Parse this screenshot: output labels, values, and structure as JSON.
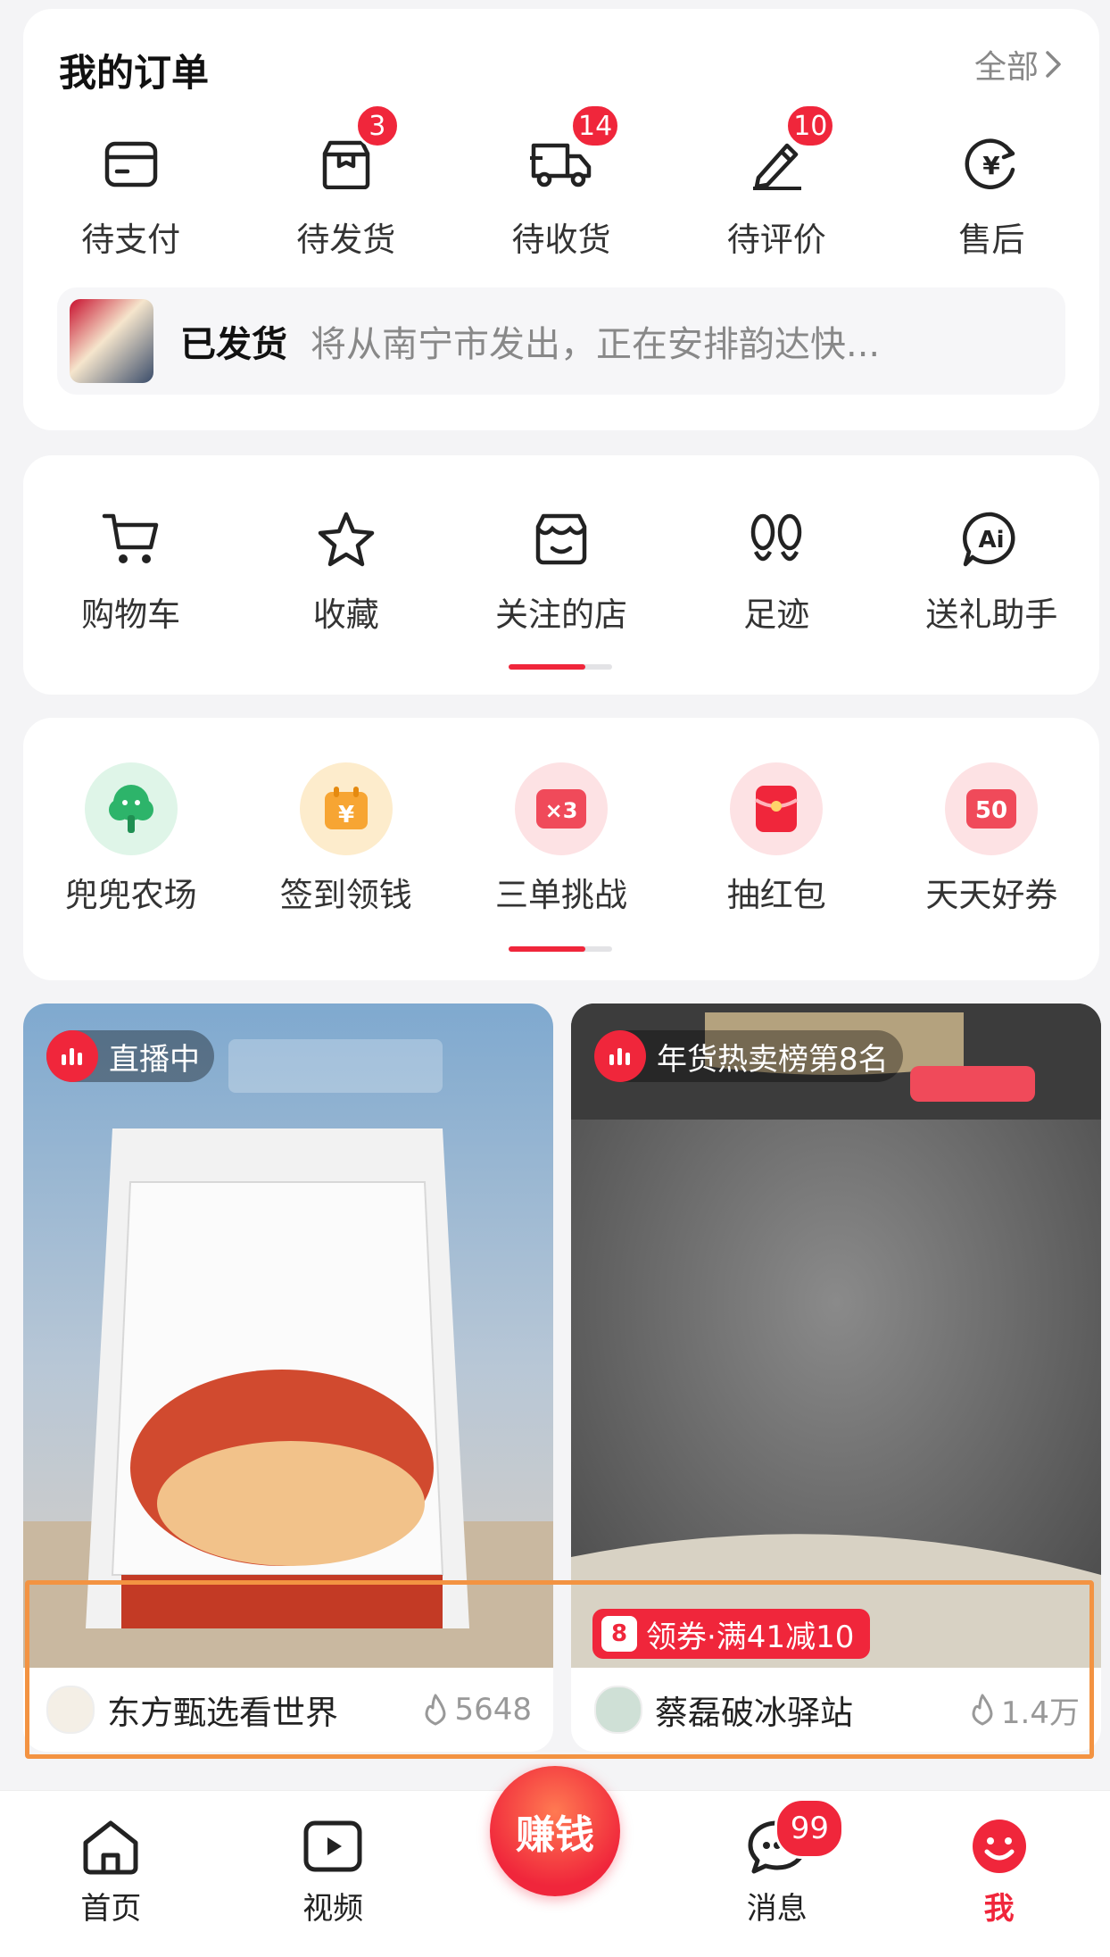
{
  "orders": {
    "title": "我的订单",
    "more": "全部",
    "items": [
      {
        "label": "待支付",
        "icon": "wallet-icon",
        "badge": ""
      },
      {
        "label": "待发货",
        "icon": "package-icon",
        "badge": "3"
      },
      {
        "label": "待收货",
        "icon": "truck-icon",
        "badge": "14"
      },
      {
        "label": "待评价",
        "icon": "pen-icon",
        "badge": "10"
      },
      {
        "label": "售后",
        "icon": "refund-icon",
        "badge": ""
      }
    ],
    "shipping": {
      "status": "已发货",
      "text": "将从南宁市发出，正在安排韵达快..."
    }
  },
  "tools": {
    "items": [
      {
        "label": "购物车",
        "icon": "cart-icon"
      },
      {
        "label": "收藏",
        "icon": "star-icon"
      },
      {
        "label": "关注的店",
        "icon": "store-icon"
      },
      {
        "label": "足迹",
        "icon": "footprint-icon"
      },
      {
        "label": "送礼助手",
        "icon": "ai-icon"
      }
    ]
  },
  "activities": {
    "items": [
      {
        "label": "兜兜农场",
        "icon": "tree-icon",
        "color": "#2db46a"
      },
      {
        "label": "签到领钱",
        "icon": "calendar-yen-icon",
        "color": "#f7a533"
      },
      {
        "label": "三单挑战",
        "icon": "ticket-x3-icon",
        "color": "#f04a5a",
        "glyph": "×3"
      },
      {
        "label": "抽红包",
        "icon": "red-envelope-icon",
        "color": "#f0263b"
      },
      {
        "label": "天天好券",
        "icon": "coupon-50-icon",
        "color": "#f04a5a",
        "glyph": "50"
      }
    ]
  },
  "feed": [
    {
      "tag": "直播中",
      "name": "东方甄选看世界",
      "heat": "5648",
      "coupon": ""
    },
    {
      "tag": "年货热卖榜第8名",
      "name": "蔡磊破冰驿站",
      "heat": "1.4万",
      "coupon": "领券·满41减10"
    }
  ],
  "nav": {
    "items": [
      {
        "label": "首页",
        "icon": "home-icon"
      },
      {
        "label": "视频",
        "icon": "video-icon"
      },
      {
        "label": "赚钱",
        "icon": "earn-icon"
      },
      {
        "label": "消息",
        "icon": "chat-icon",
        "badge": "99"
      },
      {
        "label": "我",
        "icon": "profile-icon"
      }
    ]
  },
  "colors": {
    "accent": "#f0263b",
    "highlight": "#f39342"
  }
}
